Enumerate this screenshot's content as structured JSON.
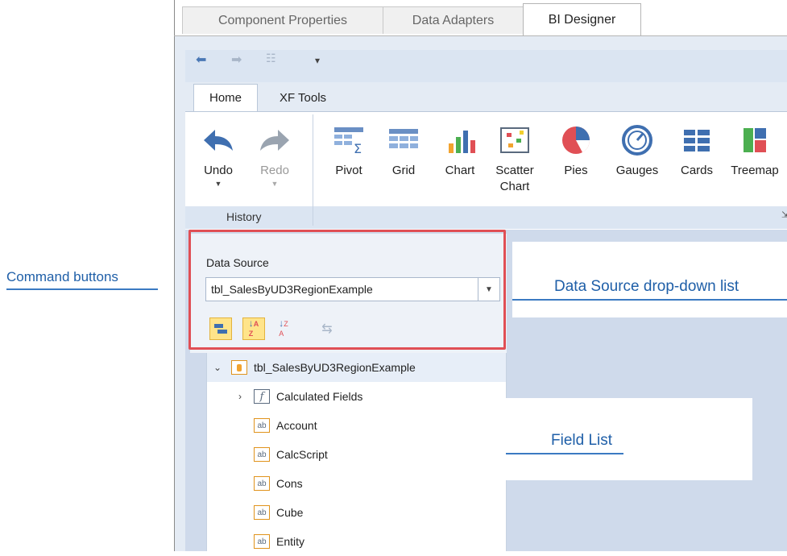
{
  "annotations": {
    "command_buttons": "Command buttons",
    "data_source_dropdown": "Data Source drop-down list",
    "field_list": "Field List"
  },
  "tabs": [
    "Component Properties",
    "Data Adapters",
    "BI Designer"
  ],
  "ribbon": {
    "tabs": [
      "Home",
      "XF Tools"
    ],
    "history": {
      "undo": "Undo",
      "redo": "Redo",
      "group_label": "History"
    },
    "items": [
      {
        "label": "Pivot",
        "icon": "pivot-icon"
      },
      {
        "label": "Grid",
        "icon": "grid-icon"
      },
      {
        "label": "Chart",
        "icon": "chart-icon"
      },
      {
        "label": "Scatter Chart",
        "icon": "scatter-chart-icon"
      },
      {
        "label": "Pies",
        "icon": "pies-icon"
      },
      {
        "label": "Gauges",
        "icon": "gauges-icon"
      },
      {
        "label": "Cards",
        "icon": "cards-icon"
      },
      {
        "label": "Treemap",
        "icon": "treemap-icon"
      }
    ]
  },
  "data_source": {
    "label": "Data Source",
    "selected": "tbl_SalesByUD3RegionExample"
  },
  "field_list": {
    "root": "tbl_SalesByUD3RegionExample",
    "items": [
      {
        "label": "Calculated Fields",
        "icon": "fx"
      },
      {
        "label": "Account",
        "icon": "ab"
      },
      {
        "label": "CalcScript",
        "icon": "ab"
      },
      {
        "label": "Cons",
        "icon": "ab"
      },
      {
        "label": "Cube",
        "icon": "ab"
      },
      {
        "label": "Entity",
        "icon": "ab"
      }
    ]
  },
  "colors": {
    "accent": "#1f5fa8",
    "highlight": "#e04f55",
    "toggle_on": "#ffe48a"
  }
}
